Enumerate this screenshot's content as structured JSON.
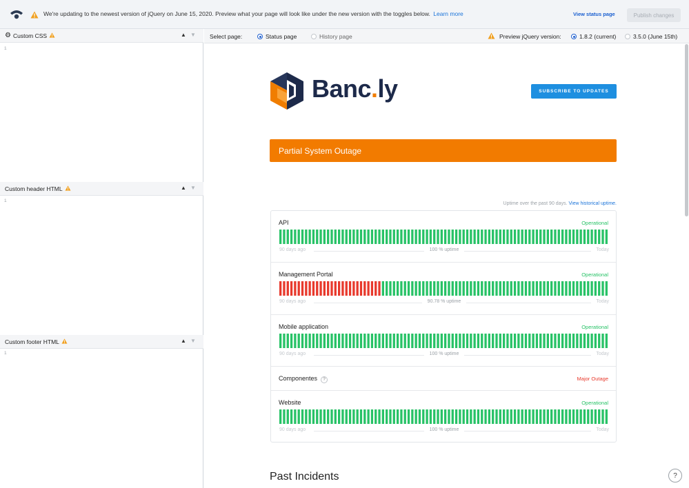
{
  "banner": {
    "message": "We're updating to the newest version of jQuery on June 15, 2020. Preview what your page will look like under the new version with the toggles below.",
    "learn_more": "Learn more",
    "view_status_page": "View status page",
    "publish_changes": "Publish changes"
  },
  "editor": {
    "sections": [
      {
        "title": "Custom CSS",
        "line": "1"
      },
      {
        "title": "Custom header HTML",
        "line": "1"
      },
      {
        "title": "Custom footer HTML",
        "line": "1"
      }
    ]
  },
  "toolbar": {
    "select_page_label": "Select page:",
    "status_page": "Status page",
    "history_page": "History page",
    "preview_label": "Preview jQuery version:",
    "version_current": "1.8.2 (current)",
    "version_new": "3.5.0 (June 15th)"
  },
  "status_page": {
    "brand_name": "Banc",
    "brand_dot": ".",
    "brand_suffix": "ly",
    "subscribe": "SUBSCRIBE TO UPDATES",
    "outage_banner": "Partial System Outage",
    "uptime_caption": "Uptime over the past 90 days.",
    "uptime_link": "View historical uptime.",
    "components": [
      {
        "name": "API",
        "status": "Operational",
        "uptime": "100 % uptime",
        "left": "90 days ago",
        "right": "Today",
        "red_days": 0
      },
      {
        "name": "Management Portal",
        "status": "Operational",
        "uptime": "90.78 % uptime",
        "left": "90 days ago",
        "right": "Today",
        "red_days": 28
      },
      {
        "name": "Mobile application",
        "status": "Operational",
        "uptime": "100 % uptime",
        "left": "90 days ago",
        "right": "Today",
        "red_days": 0
      },
      {
        "name": "Componentes",
        "status": "Major Outage",
        "help": "?"
      },
      {
        "name": "Website",
        "status": "Operational",
        "uptime": "100 % uptime",
        "left": "90 days ago",
        "right": "Today",
        "red_days": 0
      }
    ],
    "past_incidents": "Past Incidents",
    "help_button": "?",
    "colors": {
      "operational": "#27c266",
      "outage": "#e8392c",
      "accent": "#f27b00",
      "subscribe": "#1e8fe0"
    }
  }
}
